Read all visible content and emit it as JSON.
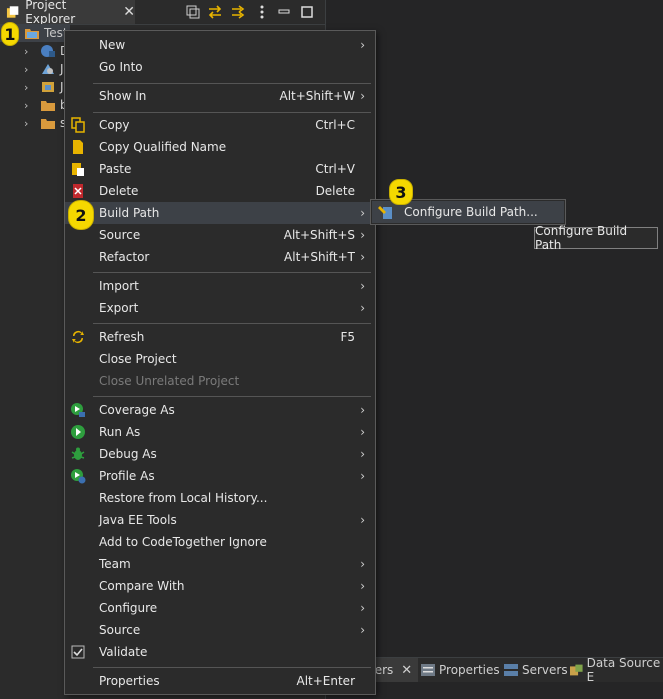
{
  "explorer": {
    "tab_title": "Project Explorer",
    "close_glyph": "✕",
    "project_label": "Test",
    "tree_items": [
      {
        "label": "D"
      },
      {
        "label": "J"
      },
      {
        "label": "J"
      },
      {
        "label": "b"
      },
      {
        "label": "s"
      }
    ]
  },
  "context_menu": {
    "items": {
      "new": {
        "label": "New"
      },
      "go_into": {
        "label": "Go Into"
      },
      "show_in": {
        "label": "Show In",
        "accel": "Alt+Shift+W"
      },
      "copy": {
        "label": "Copy",
        "accel": "Ctrl+C"
      },
      "copy_qualified": {
        "label": "Copy Qualified Name"
      },
      "paste": {
        "label": "Paste",
        "accel": "Ctrl+V"
      },
      "delete": {
        "label": "Delete",
        "accel": "Delete"
      },
      "build_path": {
        "label": "Build Path"
      },
      "source": {
        "label": "Source",
        "accel": "Alt+Shift+S"
      },
      "refactor": {
        "label": "Refactor",
        "accel": "Alt+Shift+T"
      },
      "import": {
        "label": "Import"
      },
      "export": {
        "label": "Export"
      },
      "refresh": {
        "label": "Refresh",
        "accel": "F5"
      },
      "close_project": {
        "label": "Close Project"
      },
      "close_unrelated": {
        "label": "Close Unrelated Project"
      },
      "coverage_as": {
        "label": "Coverage As"
      },
      "run_as": {
        "label": "Run As"
      },
      "debug_as": {
        "label": "Debug As"
      },
      "profile_as": {
        "label": "Profile As"
      },
      "restore_history": {
        "label": "Restore from Local History..."
      },
      "java_ee_tools": {
        "label": "Java EE Tools"
      },
      "codetogether": {
        "label": "Add to CodeTogether Ignore"
      },
      "team": {
        "label": "Team"
      },
      "compare_with": {
        "label": "Compare With"
      },
      "configure": {
        "label": "Configure"
      },
      "source2": {
        "label": "Source"
      },
      "validate": {
        "label": "Validate"
      },
      "properties": {
        "label": "Properties",
        "accel": "Alt+Enter"
      }
    },
    "arrow_glyph": "›"
  },
  "submenu": {
    "configure_build_path": "Configure Build Path..."
  },
  "tooltip": {
    "text": "Configure Build Path"
  },
  "annotations": {
    "one": "1",
    "two": "2",
    "three": "3"
  },
  "bottom_tabs": {
    "first_partial": "ters",
    "first_close": "✕",
    "properties": "Properties",
    "servers": "Servers",
    "data_source": "Data Source E"
  },
  "colors": {
    "accent_highlight": "#3d4147",
    "annotation_yellow": "#f5d800"
  }
}
